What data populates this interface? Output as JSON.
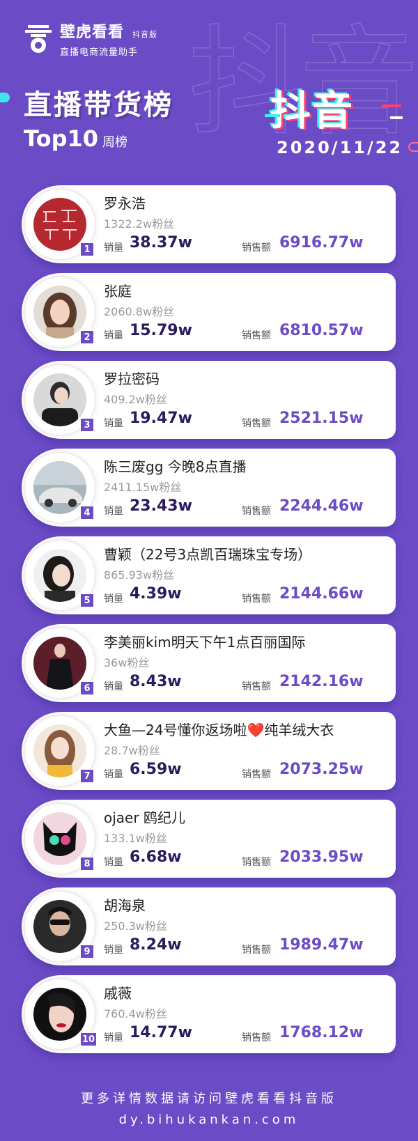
{
  "brand": {
    "name": "壁虎看看",
    "edition": "抖音版",
    "tagline": "直播电商流量助手",
    "platform": "抖音"
  },
  "title": {
    "main": "直播带货榜",
    "top": "Top10",
    "period": "周榜",
    "date": "2020/11/22"
  },
  "labels": {
    "sales": "销量",
    "amount": "销售额"
  },
  "ranking": [
    {
      "rank": "1",
      "name": "罗永浩",
      "fans": "1322.2w粉丝",
      "sales": "38.37w",
      "amount": "6916.77w"
    },
    {
      "rank": "2",
      "name": "张庭",
      "fans": "2060.8w粉丝",
      "sales": "15.79w",
      "amount": "6810.57w"
    },
    {
      "rank": "3",
      "name": "罗拉密码",
      "fans": "409.2w粉丝",
      "sales": "19.47w",
      "amount": "2521.15w"
    },
    {
      "rank": "4",
      "name": "陈三废gg 今晚8点直播",
      "fans": "2411.15w粉丝",
      "sales": "23.43w",
      "amount": "2244.46w"
    },
    {
      "rank": "5",
      "name": "曹颖（22号3点凯百瑞珠宝专场）",
      "fans": "865.93w粉丝",
      "sales": "4.39w",
      "amount": "2144.66w"
    },
    {
      "rank": "6",
      "name": "李美丽kim明天下午1点百丽国际",
      "fans": "36w粉丝",
      "sales": "8.43w",
      "amount": "2142.16w"
    },
    {
      "rank": "7",
      "name": "大鱼—24号懂你返场啦❤️纯羊绒大衣",
      "fans": "28.7w粉丝",
      "sales": "6.59w",
      "amount": "2073.25w"
    },
    {
      "rank": "8",
      "name": "ojaer 鸥纪儿",
      "fans": "133.1w粉丝",
      "sales": "6.68w",
      "amount": "2033.95w"
    },
    {
      "rank": "9",
      "name": "胡海泉",
      "fans": "250.3w粉丝",
      "sales": "8.24w",
      "amount": "1989.47w"
    },
    {
      "rank": "10",
      "name": "戚薇",
      "fans": "760.4w粉丝",
      "sales": "14.77w",
      "amount": "1768.12w"
    }
  ],
  "footer": {
    "line1": "更多详情数据请访问壁虎看看抖音版",
    "line2": "dy.bihukankan.com"
  },
  "colors": {
    "background": "#6b4bc6",
    "accent_cyan": "#3ff1ea",
    "accent_pink": "#ff3e71",
    "value_dark": "#2b1a5e"
  }
}
